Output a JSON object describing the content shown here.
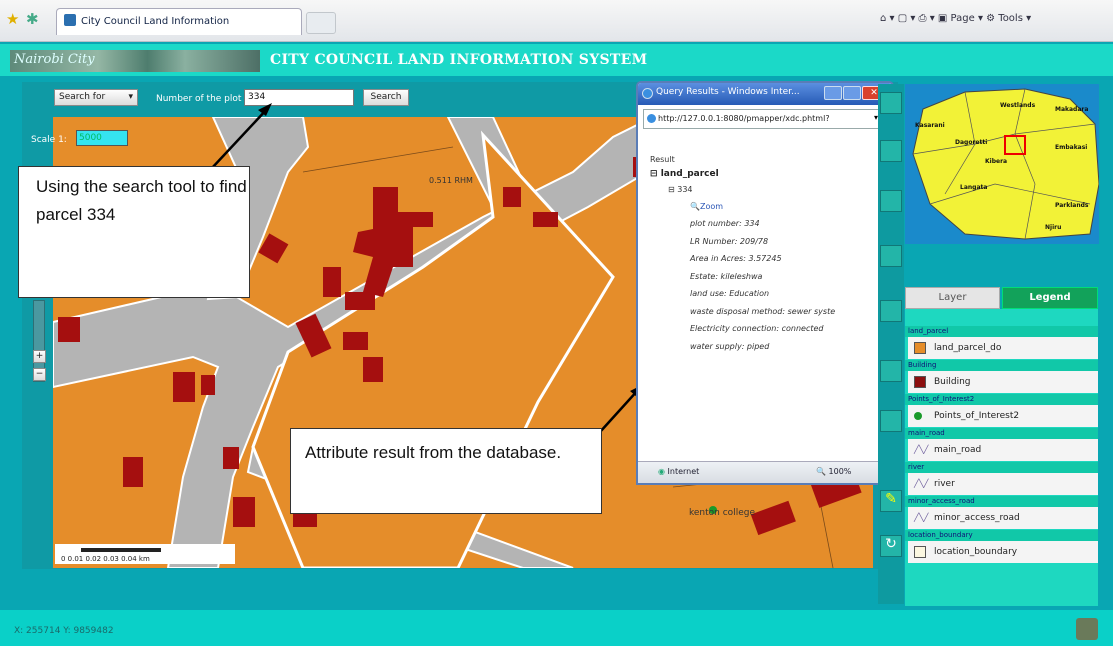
{
  "browser": {
    "tab_title": "City Council Land Information",
    "tools": "⌂ ▾  ▢ ▾  ⎙ ▾  ▣ Page ▾  ⚙ Tools ▾"
  },
  "header": {
    "logo_text": "Nairobi City",
    "title": "CITY COUNCIL LAND INFORMATION SYSTEM"
  },
  "search": {
    "select_value": "Search for",
    "plot_label": "Number of the plot",
    "plot_value": "334",
    "button_label": "Search"
  },
  "scale": {
    "label": "Scale 1:",
    "value": "5000"
  },
  "map": {
    "label_road": "0.511 RHM",
    "label_poi": "kenton college",
    "scalebar_text": "0   0.01 0.02 0.03 0.04 km"
  },
  "callouts": {
    "search_tool": "Using the search tool to find parcel 334",
    "attribute_result": "Attribute result from the database."
  },
  "popup": {
    "title": "Query Results - Windows Inter...",
    "url": "http://127.0.0.1:8080/pmapper/xdc.phtml?",
    "result_label": "Result",
    "layer": "land_parcel",
    "id": "334",
    "zoom": "Zoom",
    "attributes": [
      "plot number:  334",
      "LR Number:  209/78",
      "Area in Acres:  3.57245",
      "Estate:  kileleshwa",
      "land use:  Education",
      "waste disposal method:  sewer syste",
      "Electricity connection:  connected",
      "water supply:  piped"
    ],
    "status_zone": "Internet",
    "status_zoom": "100%"
  },
  "panel": {
    "tab_layer": "Layer",
    "tab_legend": "Legend",
    "legend": [
      {
        "category": "land_parcel",
        "item": "land_parcel_do",
        "color": "#e58d2a",
        "symbol": "square"
      },
      {
        "category": "Building",
        "item": "Building",
        "color": "#8b0e0e",
        "symbol": "square"
      },
      {
        "category": "Points_of_Interest2",
        "item": "Points_of_Interest2",
        "color": "#1a9a2a",
        "symbol": "dot"
      },
      {
        "category": "main_road",
        "item": "main_road",
        "color": "#6a5a9a",
        "symbol": "line"
      },
      {
        "category": "river",
        "item": "river",
        "color": "#6a5a9a",
        "symbol": "line"
      },
      {
        "category": "minor_access_road",
        "item": "minor_access_road",
        "color": "#6a5a9a",
        "symbol": "line"
      },
      {
        "category": "location_boundary",
        "item": "location_boundary",
        "color": "#fbf7e0",
        "symbol": "square"
      }
    ],
    "overview_labels": [
      "Westlands",
      "Kasarani",
      "Dagoretti",
      "Makadara",
      "Embakasi",
      "Kibera",
      "Langata",
      "Parklands",
      "Njiru"
    ]
  },
  "footer": {
    "coords": "X: 255714   Y: 9859482"
  }
}
